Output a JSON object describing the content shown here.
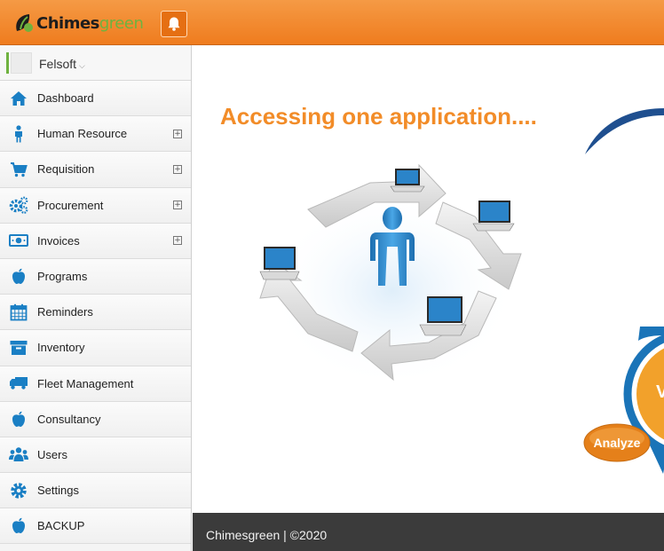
{
  "header": {
    "logo_part1": "Chimes",
    "logo_part2": "green",
    "notification_icon": "bell-icon"
  },
  "sidebar": {
    "company_name": "Felsoft",
    "items": [
      {
        "label": "Dashboard",
        "icon": "home-icon",
        "expandable": false
      },
      {
        "label": "Human Resource",
        "icon": "person-icon",
        "expandable": true
      },
      {
        "label": "Requisition",
        "icon": "cart-icon",
        "expandable": true
      },
      {
        "label": "Procurement",
        "icon": "gears-icon",
        "expandable": true
      },
      {
        "label": "Invoices",
        "icon": "money-icon",
        "expandable": true
      },
      {
        "label": "Programs",
        "icon": "apple-icon",
        "expandable": false
      },
      {
        "label": "Reminders",
        "icon": "calendar-icon",
        "expandable": false
      },
      {
        "label": "Inventory",
        "icon": "archive-icon",
        "expandable": false
      },
      {
        "label": "Fleet Management",
        "icon": "truck-icon",
        "expandable": false
      },
      {
        "label": "Consultancy",
        "icon": "apple-icon",
        "expandable": false
      },
      {
        "label": "Users",
        "icon": "users-icon",
        "expandable": false
      },
      {
        "label": "Settings",
        "icon": "gear-icon",
        "expandable": false
      },
      {
        "label": "BACKUP",
        "icon": "apple-icon",
        "expandable": false
      }
    ]
  },
  "main": {
    "headline": "Accessing one application....",
    "cycle_label": "Analyze"
  },
  "footer": {
    "text": "Chimesgreen | ©2020"
  },
  "colors": {
    "header_orange": "#ef7c1e",
    "accent_orange": "#f28c28",
    "brand_green": "#6fb23f",
    "icon_blue": "#1a7fc4",
    "footer_bg": "#3b3b3b"
  }
}
